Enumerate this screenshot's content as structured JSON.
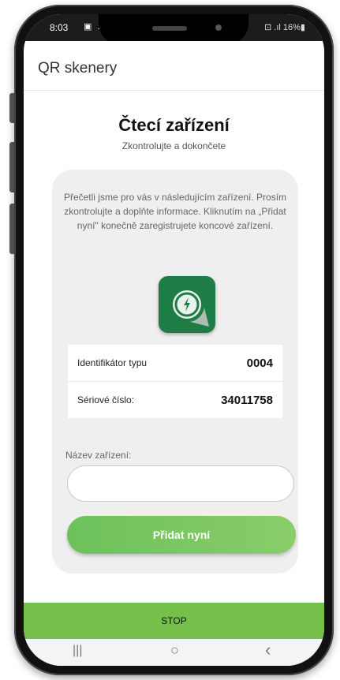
{
  "status_bar": {
    "time": "8:03",
    "left_icons": "▣ ☁",
    "right_text": "⊡ .ıl 16%▮"
  },
  "app_bar": {
    "title": "QR skenery"
  },
  "header": {
    "title": "Čtecí zařízení",
    "subtitle": "Zkontrolujte a dokončete"
  },
  "card": {
    "intro": "Přečetli jsme pro vás v následujícím zařízení. Prosím zkontrolujte a doplňte informace. Kliknutím na „Přidat nyní\" konečně zaregistrujete koncové zařízení.",
    "app_icon": "scanner-app-icon",
    "rows": [
      {
        "label": "Identifikátor typu",
        "value": "0004"
      },
      {
        "label": "Sériové číslo:",
        "value": "34011758"
      }
    ],
    "name_field": {
      "label": "Název zařízení:",
      "value": "",
      "placeholder": ""
    },
    "add_button": "Přidat nyní"
  },
  "stop_button": "STOP",
  "nav": {
    "recents": "|||",
    "home": "○",
    "back": "‹"
  },
  "colors": {
    "accent": "#75bf4b",
    "icon_green": "#1e7d45",
    "card_bg": "#efefef"
  }
}
